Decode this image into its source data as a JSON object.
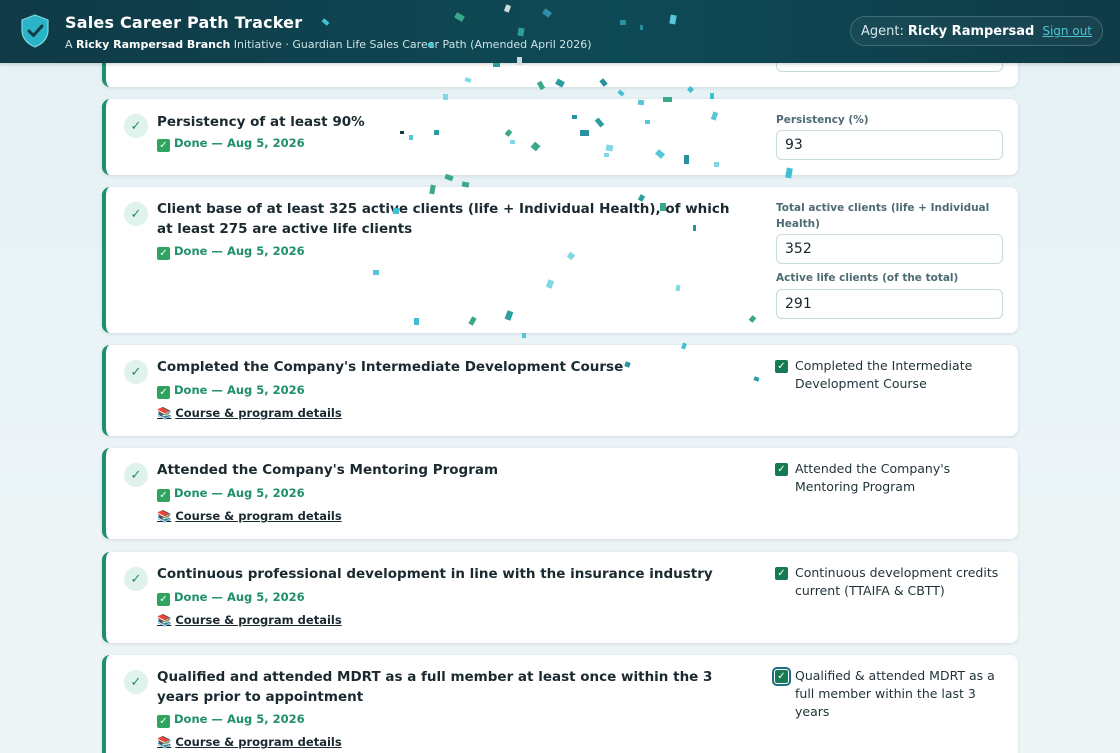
{
  "header": {
    "title": "Sales Career Path Tracker",
    "sub_prefix": "A ",
    "sub_branch": "Ricky Rampersad Branch",
    "sub_suffix": " Initiative · Guardian Life Sales Career Path (Amended April 2026)",
    "agent_label": "Agent:",
    "agent_name": "Ricky Rampersad",
    "signout": "Sign out"
  },
  "colors": {
    "header_bg": "#0f3a46",
    "accent_green": "#1e8f6a",
    "link": "#4fc3d4"
  },
  "cards": [
    {
      "title": "Persistency of at least 90%",
      "status": "Done — Aug 5, 2026",
      "field_label": "Persistency (%)",
      "field_value": "93"
    },
    {
      "title": "Client base of at least 325 active clients (life + Individual Health), of which at least 275 are active life clients",
      "status": "Done — Aug 5, 2026",
      "field1_label": "Total active clients (life + Individual Health)",
      "field1_value": "352",
      "field2_label": "Active life clients (of the total)",
      "field2_value": "291"
    },
    {
      "title": "Completed the Company's Intermediate Development Course",
      "status": "Done — Aug 5, 2026",
      "details": "Course & program details",
      "checkbox": "Completed the Intermediate Development Course"
    },
    {
      "title": "Attended the Company's Mentoring Program",
      "status": "Done — Aug 5, 2026",
      "details": "Course & program details",
      "checkbox": "Attended the Company's Mentoring Program"
    },
    {
      "title": "Continuous professional development in line with the insurance industry",
      "status": "Done — Aug 5, 2026",
      "details": "Course & program details",
      "checkbox": "Continuous development credits current (TTAIFA & CBTT)"
    },
    {
      "title": "Qualified and attended MDRT as a full member at least once within the 3 years prior to appointment",
      "status": "Done — Aug 5, 2026",
      "details": "Course & program details",
      "checkbox": "Qualified & attended MDRT as a full member within the last 3 years"
    }
  ]
}
